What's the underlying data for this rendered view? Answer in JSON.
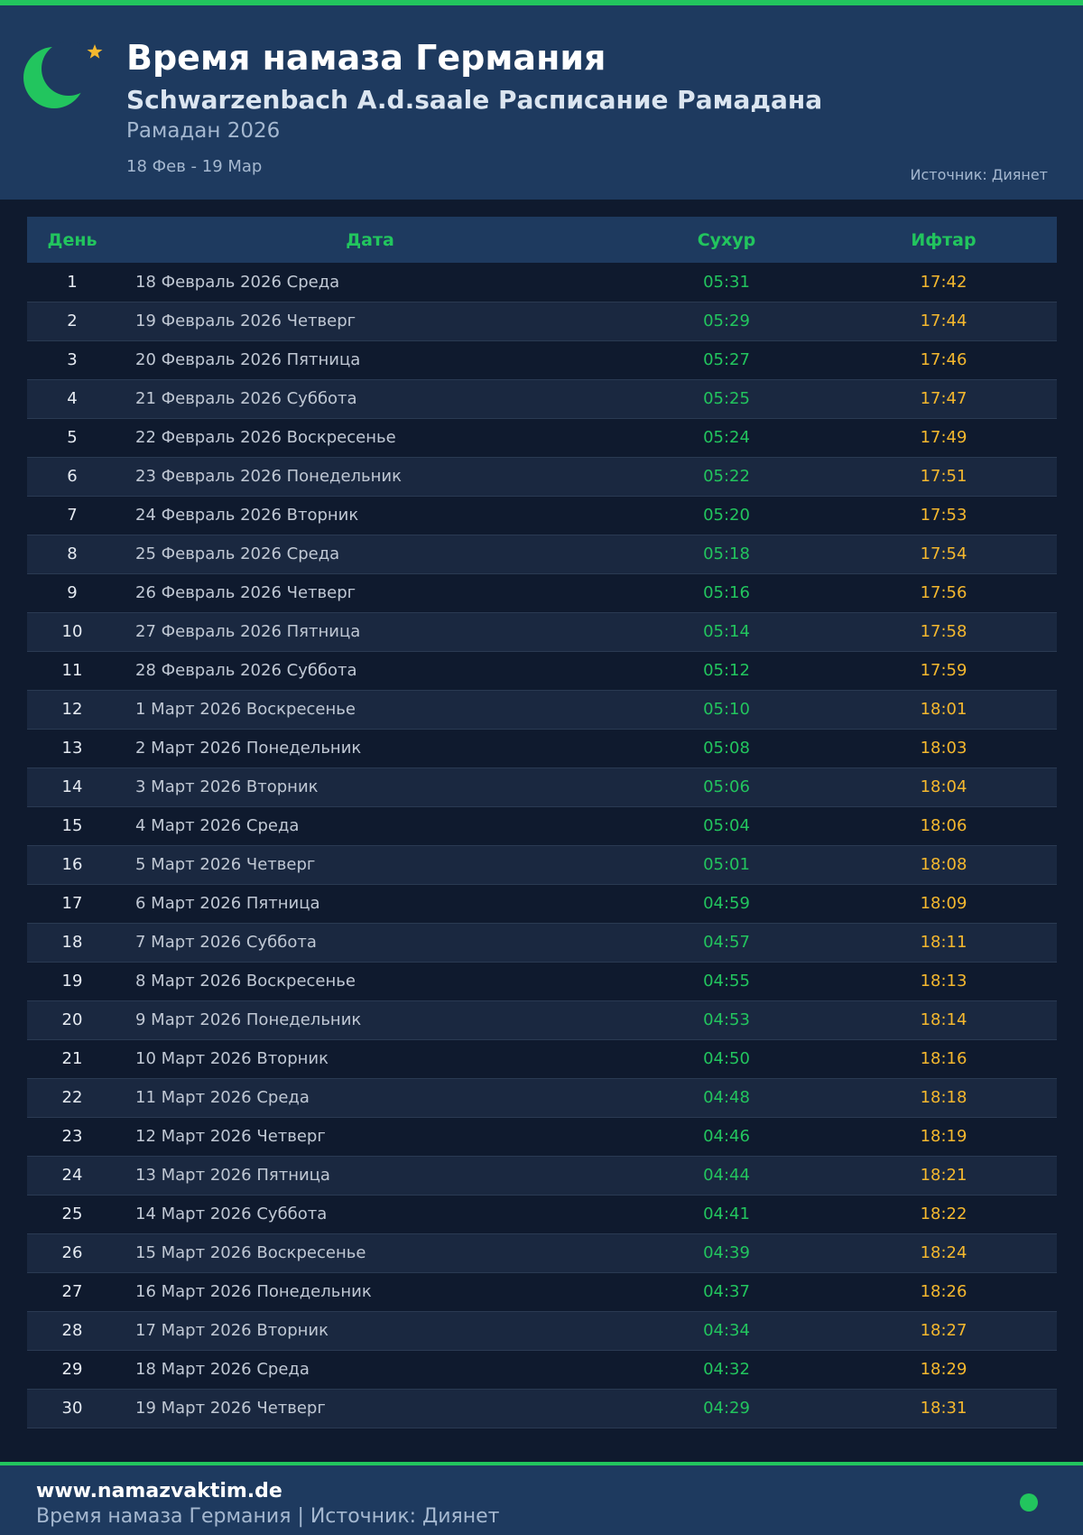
{
  "header": {
    "title": "Время намаза Германия",
    "subtitle": "Schwarzenbach A.d.saale Расписание Рамадана",
    "ramadan": "Рамадан 2026",
    "range": "18 Фев - 19 Мар",
    "source": "Источник: Диянет",
    "logo_icon": "crescent-star-icon"
  },
  "colors": {
    "accent_green": "#22c55e",
    "iftar_gold": "#f5b82e",
    "header_bg": "#1e3a5f",
    "page_bg": "#0f1a2e"
  },
  "table": {
    "headers": [
      "День",
      "Дата",
      "Сухур",
      "Ифтар"
    ],
    "rows": [
      {
        "day": "1",
        "date": "18 Февраль 2026 Среда",
        "suhur": "05:31",
        "iftar": "17:42"
      },
      {
        "day": "2",
        "date": "19 Февраль 2026 Четверг",
        "suhur": "05:29",
        "iftar": "17:44"
      },
      {
        "day": "3",
        "date": "20 Февраль 2026 Пятница",
        "suhur": "05:27",
        "iftar": "17:46"
      },
      {
        "day": "4",
        "date": "21 Февраль 2026 Суббота",
        "suhur": "05:25",
        "iftar": "17:47"
      },
      {
        "day": "5",
        "date": "22 Февраль 2026 Воскресенье",
        "suhur": "05:24",
        "iftar": "17:49"
      },
      {
        "day": "6",
        "date": "23 Февраль 2026 Понедельник",
        "suhur": "05:22",
        "iftar": "17:51"
      },
      {
        "day": "7",
        "date": "24 Февраль 2026 Вторник",
        "suhur": "05:20",
        "iftar": "17:53"
      },
      {
        "day": "8",
        "date": "25 Февраль 2026 Среда",
        "suhur": "05:18",
        "iftar": "17:54"
      },
      {
        "day": "9",
        "date": "26 Февраль 2026 Четверг",
        "suhur": "05:16",
        "iftar": "17:56"
      },
      {
        "day": "10",
        "date": "27 Февраль 2026 Пятница",
        "suhur": "05:14",
        "iftar": "17:58"
      },
      {
        "day": "11",
        "date": "28 Февраль 2026 Суббота",
        "suhur": "05:12",
        "iftar": "17:59"
      },
      {
        "day": "12",
        "date": "1 Март 2026 Воскресенье",
        "suhur": "05:10",
        "iftar": "18:01"
      },
      {
        "day": "13",
        "date": "2 Март 2026 Понедельник",
        "suhur": "05:08",
        "iftar": "18:03"
      },
      {
        "day": "14",
        "date": "3 Март 2026 Вторник",
        "suhur": "05:06",
        "iftar": "18:04"
      },
      {
        "day": "15",
        "date": "4 Март 2026 Среда",
        "suhur": "05:04",
        "iftar": "18:06"
      },
      {
        "day": "16",
        "date": "5 Март 2026 Четверг",
        "suhur": "05:01",
        "iftar": "18:08"
      },
      {
        "day": "17",
        "date": "6 Март 2026 Пятница",
        "suhur": "04:59",
        "iftar": "18:09"
      },
      {
        "day": "18",
        "date": "7 Март 2026 Суббота",
        "suhur": "04:57",
        "iftar": "18:11"
      },
      {
        "day": "19",
        "date": "8 Март 2026 Воскресенье",
        "suhur": "04:55",
        "iftar": "18:13"
      },
      {
        "day": "20",
        "date": "9 Март 2026 Понедельник",
        "suhur": "04:53",
        "iftar": "18:14"
      },
      {
        "day": "21",
        "date": "10 Март 2026 Вторник",
        "suhur": "04:50",
        "iftar": "18:16"
      },
      {
        "day": "22",
        "date": "11 Март 2026 Среда",
        "suhur": "04:48",
        "iftar": "18:18"
      },
      {
        "day": "23",
        "date": "12 Март 2026 Четверг",
        "suhur": "04:46",
        "iftar": "18:19"
      },
      {
        "day": "24",
        "date": "13 Март 2026 Пятница",
        "suhur": "04:44",
        "iftar": "18:21"
      },
      {
        "day": "25",
        "date": "14 Март 2026 Суббота",
        "suhur": "04:41",
        "iftar": "18:22"
      },
      {
        "day": "26",
        "date": "15 Март 2026 Воскресенье",
        "suhur": "04:39",
        "iftar": "18:24"
      },
      {
        "day": "27",
        "date": "16 Март 2026 Понедельник",
        "suhur": "04:37",
        "iftar": "18:26"
      },
      {
        "day": "28",
        "date": "17 Март 2026 Вторник",
        "suhur": "04:34",
        "iftar": "18:27"
      },
      {
        "day": "29",
        "date": "18 Март 2026 Среда",
        "suhur": "04:32",
        "iftar": "18:29"
      },
      {
        "day": "30",
        "date": "19 Март 2026 Четверг",
        "suhur": "04:29",
        "iftar": "18:31"
      }
    ]
  },
  "footer": {
    "site": "www.namazvaktim.de",
    "text": "Время намаза Германия | Источник: Диянет",
    "status_icon": "status-dot-icon"
  }
}
